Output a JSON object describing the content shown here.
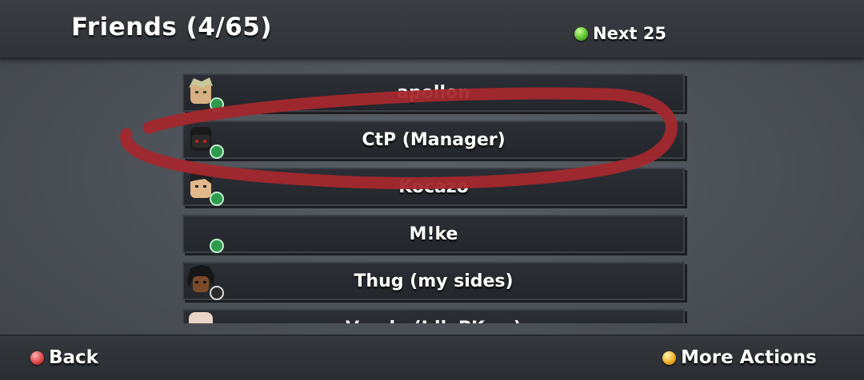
{
  "header": {
    "title": "Friends (4/65)",
    "next_label": "Next 25",
    "next_icon": "green-button-icon"
  },
  "friends": [
    {
      "name": "apollon",
      "status": "online"
    },
    {
      "name": "CtP (Manager)",
      "status": "online"
    },
    {
      "name": "Kocazo",
      "status": "online"
    },
    {
      "name": "M!ke",
      "status": "online"
    },
    {
      "name": "Thug (my sides)",
      "status": "offline"
    },
    {
      "name": "Vanda (Idk PK so)",
      "status": "offline"
    }
  ],
  "footer": {
    "back_label": "Back",
    "back_icon": "red-button-icon",
    "more_label": "More Actions",
    "more_icon": "yellow-button-icon"
  },
  "annotation": {
    "color": "#a3282d",
    "description_shape": "hand-drawn ellipse circling a friend row"
  }
}
